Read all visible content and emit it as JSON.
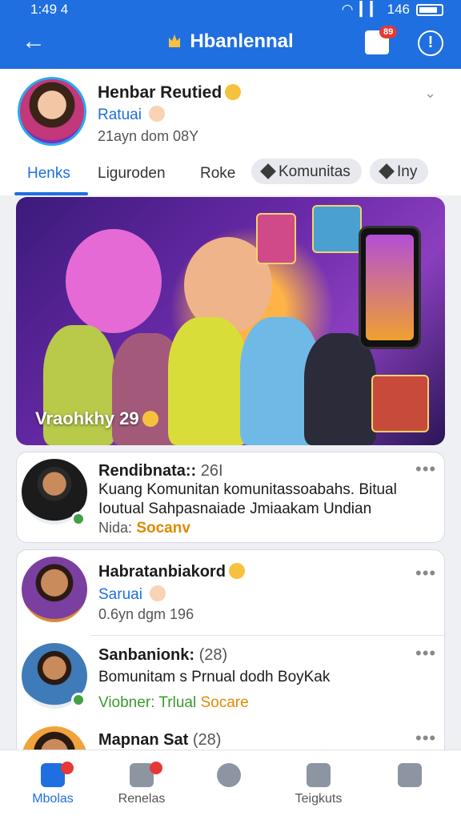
{
  "status_bar": {
    "time": "1:49 4",
    "battery": "146"
  },
  "header": {
    "title": "Hbanlennal",
    "notification_count": "89"
  },
  "profile": {
    "name": "Henbar Reutied",
    "role": "Ratuai",
    "meta": "21ayn dom 08Y"
  },
  "tabs": [
    {
      "label": "Henks"
    },
    {
      "label": "Liguroden"
    },
    {
      "label": "Roke"
    },
    {
      "label": "Komunitas"
    },
    {
      "label": "Iny"
    }
  ],
  "hero": {
    "caption": "Vraohkhy 29"
  },
  "posts": [
    {
      "title": "Rendibnata::",
      "count": "26I",
      "line1": "Kuang Komunitan komunitassoabahs. Bitual",
      "line2": "Ioutual Sahpasnaiade Jmiaakam Undian",
      "label": "Nida:",
      "tag": "Socanv"
    },
    {
      "title": "Habratanbiakord",
      "role": "Saruai",
      "meta": "0.6yn dgm 196"
    },
    {
      "title": "Sanbanionk:",
      "count": "(28)",
      "line1": "Bomunitam s Prnual dodh BoyKak",
      "label": "Viobner:",
      "tag1": "Trlual",
      "tag2": "Socare"
    },
    {
      "title": "Mapnan Sat",
      "count": "(28)"
    }
  ],
  "bottom_nav": [
    {
      "label": "Mbolas"
    },
    {
      "label": "Renelas"
    },
    {
      "label": ""
    },
    {
      "label": "Teigkuts"
    },
    {
      "label": ""
    }
  ]
}
